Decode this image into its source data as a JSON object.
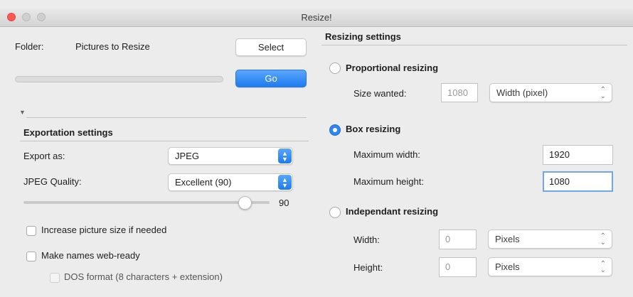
{
  "window": {
    "title": "Resize!"
  },
  "folder": {
    "label": "Folder:",
    "value": "Pictures to Resize",
    "select_button": "Select"
  },
  "progress": {
    "fraction": 0,
    "go_button": "Go"
  },
  "export": {
    "section_title": "Exportation settings",
    "format_label": "Export as:",
    "format_value": "JPEG",
    "quality_label": "JPEG Quality:",
    "quality_value": "Excellent (90)",
    "quality_slider_value": 90,
    "quality_slider_text": "90",
    "increase_size_label": "Increase picture size if needed",
    "web_ready_label": "Make names web-ready",
    "dos_format_label": "DOS format (8 characters + extension)"
  },
  "resizing": {
    "section_title": "Resizing settings",
    "proportional": {
      "label": "Proportional resizing",
      "size_label": "Size wanted:",
      "size_value": "1080",
      "unit_value": "Width (pixel)"
    },
    "box": {
      "label": "Box resizing",
      "max_width_label": "Maximum width:",
      "max_width_value": "1920",
      "max_height_label": "Maximum height:",
      "max_height_value": "1080"
    },
    "independent": {
      "label": "Independant resizing",
      "width_label": "Width:",
      "width_value": "0",
      "width_unit": "Pixels",
      "height_label": "Height:",
      "height_value": "0",
      "height_unit": "Pixels"
    }
  },
  "colors": {
    "accent": "#1d7bf0",
    "close": "#fc5753",
    "inactive_light": "#cfcfcf"
  }
}
